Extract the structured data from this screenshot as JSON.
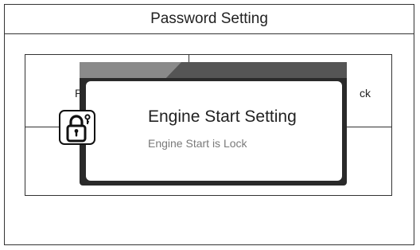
{
  "screen": {
    "title": "Password Setting"
  },
  "background_panel": {
    "left_text_fragment": "P",
    "right_text_fragment": "ck"
  },
  "dialog": {
    "title": "Engine Start Setting",
    "message": "Engine Start is Lock",
    "icon": "lock-icon"
  }
}
